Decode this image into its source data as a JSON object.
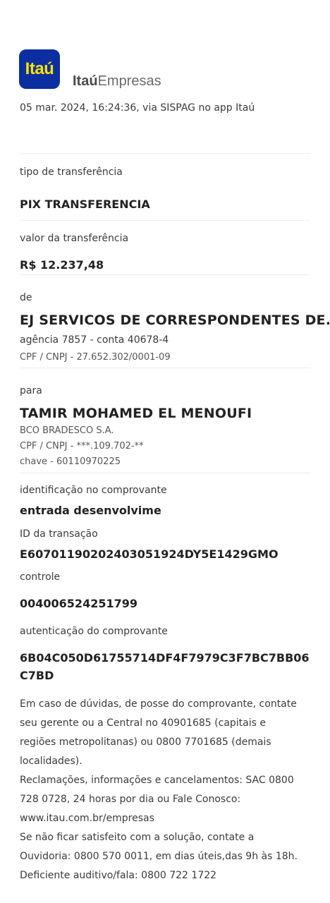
{
  "header": {
    "logo_text": "Itaú",
    "brand_bold": "Itaú",
    "brand_rest": "Empresas",
    "timestamp": "05 mar. 2024, 16:24:36, via SISPAG no app Itaú"
  },
  "transfer": {
    "type_label": "tipo de transferência",
    "type_value": "PIX TRANSFERENCIA",
    "amount_label": "valor da transferência",
    "amount_value": "R$ 12.237,48"
  },
  "sender": {
    "label": "de",
    "name": "EJ SERVICOS DE CORRESPONDENTES DE...",
    "account": "agência 7857 - conta 40678-4",
    "doc": "CPF / CNPJ - 27.652.302/0001-09"
  },
  "recipient": {
    "label": "para",
    "name": "TAMIR MOHAMED EL MENOUFI",
    "bank": "BCO BRADESCO S.A.",
    "doc": "CPF / CNPJ - ***.109.702-**",
    "key": "chave - 60110970225"
  },
  "details": {
    "id_label": "identificação no comprovante",
    "id_value": "entrada desenvolvime",
    "txid_label": "ID da transação",
    "txid_value": "E60701190202403051924DY5E1429GMO",
    "control_label": "controle",
    "control_value": "004006524251799",
    "auth_label": "autenticação do comprovante",
    "auth_value": "6B04C050D61755714DF4F7979C3F7BC7BB06C7BD"
  },
  "footer": {
    "lines": [
      "Em caso de dúvidas, de posse do comprovante, contate",
      "seu gerente ou a Central no 40901685 (capitais e",
      "regiões metropolitanas) ou 0800 7701685 (demais",
      "localidades).",
      "Reclamações, informações e cancelamentos: SAC 0800",
      "728 0728, 24 horas por dia ou Fale Conosco:",
      "www.itau.com.br/empresas",
      "Se não ficar satisfeito com a solução, contate a",
      "Ouvidoria:  0800 570 0011, em dias úteis,das 9h às 18h.",
      "Deficiente auditivo/fala: 0800 722 1722"
    ]
  }
}
